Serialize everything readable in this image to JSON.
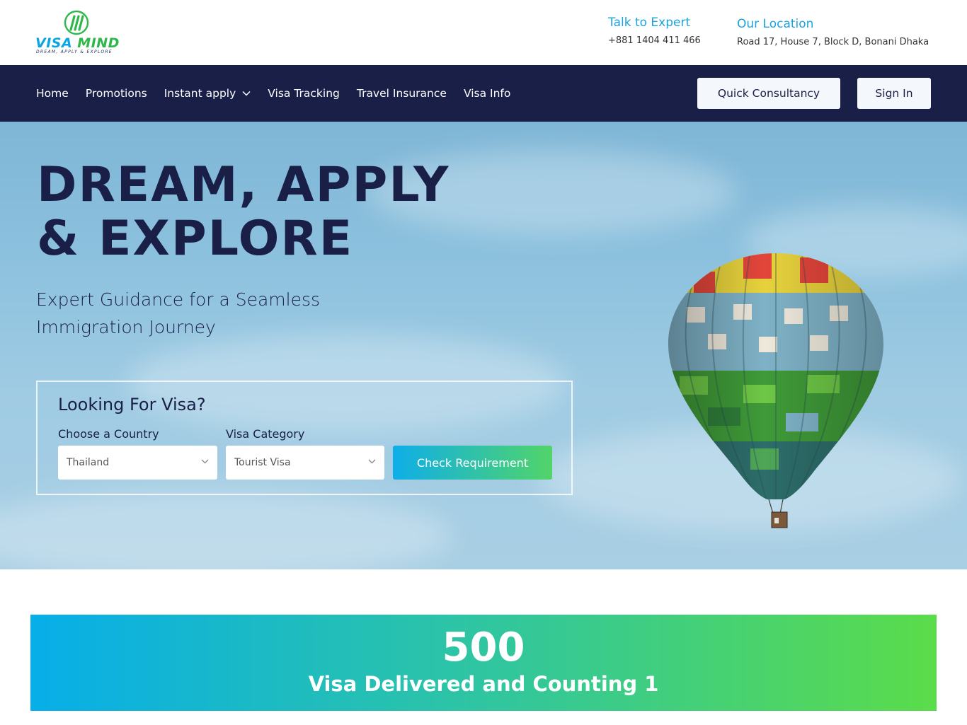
{
  "logo": {
    "name_part1": "VISA",
    "name_part2": "MIND",
    "tagline": "DREAM, APPLY & EXPLORE"
  },
  "header": {
    "expert": {
      "title": "Talk to Expert",
      "phone": "+881 1404 411 466"
    },
    "location": {
      "title": "Our Location",
      "address": "Road 17, House 7, Block D, Bonani Dhaka"
    }
  },
  "nav": {
    "items": [
      {
        "label": "Home"
      },
      {
        "label": "Promotions"
      },
      {
        "label": "Instant apply",
        "has_dropdown": true
      },
      {
        "label": "Visa Tracking"
      },
      {
        "label": "Travel Insurance"
      },
      {
        "label": "Visa Info"
      }
    ],
    "consultancy_label": "Quick Consultancy",
    "signin_label": "Sign In"
  },
  "hero": {
    "title": "DREAM, APPLY & EXPLORE",
    "subtitle": "Expert Guidance for a Seamless Immigration Journey"
  },
  "visa_search": {
    "title": "Looking For Visa?",
    "country_label": "Choose a Country",
    "country_value": "Thailand",
    "category_label": "Visa Category",
    "category_value": "Tourist Visa",
    "submit_label": "Check Requirement"
  },
  "counter": {
    "number": "500",
    "label": "Visa Delivered and Counting 1"
  },
  "colors": {
    "navy": "#1a1f48",
    "accent_blue": "#1ba3df",
    "accent_green": "#52d46a",
    "sky": "#8cc1de"
  }
}
